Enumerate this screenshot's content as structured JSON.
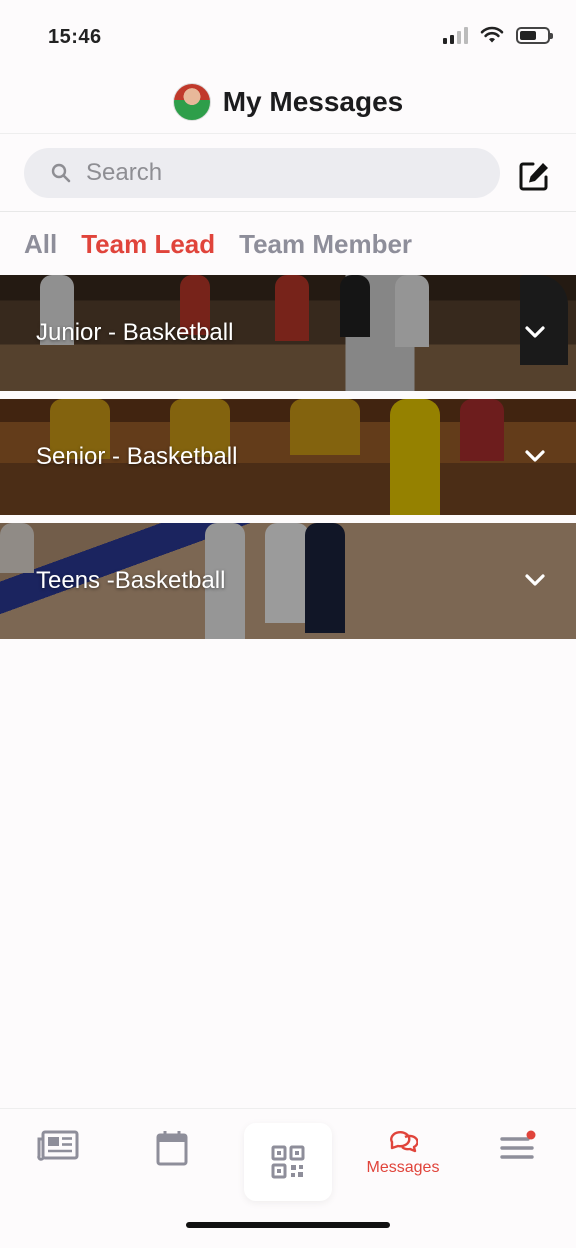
{
  "status_bar": {
    "time": "15:46"
  },
  "header": {
    "title": "My Messages"
  },
  "search": {
    "placeholder": "Search"
  },
  "tabs": [
    {
      "label": "All",
      "active": false
    },
    {
      "label": "Team Lead",
      "active": true
    },
    {
      "label": "Team Member",
      "active": false
    }
  ],
  "groups": [
    {
      "label": "Junior - Basketball"
    },
    {
      "label": "Senior - Basketball"
    },
    {
      "label": "Teens -Basketball"
    }
  ],
  "bottom_nav": {
    "items": [
      {
        "icon": "newspaper-icon",
        "label": ""
      },
      {
        "icon": "calendar-icon",
        "label": ""
      },
      {
        "icon": "qr-code-icon",
        "label": ""
      },
      {
        "icon": "chat-bubbles-icon",
        "label": "Messages",
        "active": true
      },
      {
        "icon": "menu-icon",
        "label": ""
      }
    ]
  },
  "colors": {
    "accent": "#e0443b",
    "inactive": "#8e8e9a",
    "background": "#fdfbfc"
  }
}
